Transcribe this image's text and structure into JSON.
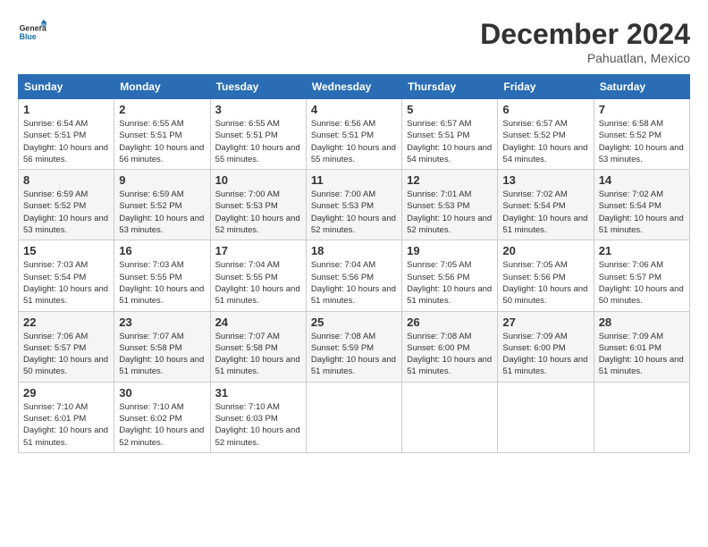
{
  "logo": {
    "general": "General",
    "blue": "Blue"
  },
  "title": {
    "month_year": "December 2024",
    "location": "Pahuatlan, Mexico"
  },
  "calendar": {
    "headers": [
      "Sunday",
      "Monday",
      "Tuesday",
      "Wednesday",
      "Thursday",
      "Friday",
      "Saturday"
    ],
    "weeks": [
      [
        {
          "day": "1",
          "sunrise": "6:54 AM",
          "sunset": "5:51 PM",
          "daylight": "10 hours and 56 minutes."
        },
        {
          "day": "2",
          "sunrise": "6:55 AM",
          "sunset": "5:51 PM",
          "daylight": "10 hours and 56 minutes."
        },
        {
          "day": "3",
          "sunrise": "6:55 AM",
          "sunset": "5:51 PM",
          "daylight": "10 hours and 55 minutes."
        },
        {
          "day": "4",
          "sunrise": "6:56 AM",
          "sunset": "5:51 PM",
          "daylight": "10 hours and 55 minutes."
        },
        {
          "day": "5",
          "sunrise": "6:57 AM",
          "sunset": "5:51 PM",
          "daylight": "10 hours and 54 minutes."
        },
        {
          "day": "6",
          "sunrise": "6:57 AM",
          "sunset": "5:52 PM",
          "daylight": "10 hours and 54 minutes."
        },
        {
          "day": "7",
          "sunrise": "6:58 AM",
          "sunset": "5:52 PM",
          "daylight": "10 hours and 53 minutes."
        }
      ],
      [
        {
          "day": "8",
          "sunrise": "6:59 AM",
          "sunset": "5:52 PM",
          "daylight": "10 hours and 53 minutes."
        },
        {
          "day": "9",
          "sunrise": "6:59 AM",
          "sunset": "5:52 PM",
          "daylight": "10 hours and 53 minutes."
        },
        {
          "day": "10",
          "sunrise": "7:00 AM",
          "sunset": "5:53 PM",
          "daylight": "10 hours and 52 minutes."
        },
        {
          "day": "11",
          "sunrise": "7:00 AM",
          "sunset": "5:53 PM",
          "daylight": "10 hours and 52 minutes."
        },
        {
          "day": "12",
          "sunrise": "7:01 AM",
          "sunset": "5:53 PM",
          "daylight": "10 hours and 52 minutes."
        },
        {
          "day": "13",
          "sunrise": "7:02 AM",
          "sunset": "5:54 PM",
          "daylight": "10 hours and 51 minutes."
        },
        {
          "day": "14",
          "sunrise": "7:02 AM",
          "sunset": "5:54 PM",
          "daylight": "10 hours and 51 minutes."
        }
      ],
      [
        {
          "day": "15",
          "sunrise": "7:03 AM",
          "sunset": "5:54 PM",
          "daylight": "10 hours and 51 minutes."
        },
        {
          "day": "16",
          "sunrise": "7:03 AM",
          "sunset": "5:55 PM",
          "daylight": "10 hours and 51 minutes."
        },
        {
          "day": "17",
          "sunrise": "7:04 AM",
          "sunset": "5:55 PM",
          "daylight": "10 hours and 51 minutes."
        },
        {
          "day": "18",
          "sunrise": "7:04 AM",
          "sunset": "5:56 PM",
          "daylight": "10 hours and 51 minutes."
        },
        {
          "day": "19",
          "sunrise": "7:05 AM",
          "sunset": "5:56 PM",
          "daylight": "10 hours and 51 minutes."
        },
        {
          "day": "20",
          "sunrise": "7:05 AM",
          "sunset": "5:56 PM",
          "daylight": "10 hours and 50 minutes."
        },
        {
          "day": "21",
          "sunrise": "7:06 AM",
          "sunset": "5:57 PM",
          "daylight": "10 hours and 50 minutes."
        }
      ],
      [
        {
          "day": "22",
          "sunrise": "7:06 AM",
          "sunset": "5:57 PM",
          "daylight": "10 hours and 50 minutes."
        },
        {
          "day": "23",
          "sunrise": "7:07 AM",
          "sunset": "5:58 PM",
          "daylight": "10 hours and 51 minutes."
        },
        {
          "day": "24",
          "sunrise": "7:07 AM",
          "sunset": "5:58 PM",
          "daylight": "10 hours and 51 minutes."
        },
        {
          "day": "25",
          "sunrise": "7:08 AM",
          "sunset": "5:59 PM",
          "daylight": "10 hours and 51 minutes."
        },
        {
          "day": "26",
          "sunrise": "7:08 AM",
          "sunset": "6:00 PM",
          "daylight": "10 hours and 51 minutes."
        },
        {
          "day": "27",
          "sunrise": "7:09 AM",
          "sunset": "6:00 PM",
          "daylight": "10 hours and 51 minutes."
        },
        {
          "day": "28",
          "sunrise": "7:09 AM",
          "sunset": "6:01 PM",
          "daylight": "10 hours and 51 minutes."
        }
      ],
      [
        {
          "day": "29",
          "sunrise": "7:10 AM",
          "sunset": "6:01 PM",
          "daylight": "10 hours and 51 minutes."
        },
        {
          "day": "30",
          "sunrise": "7:10 AM",
          "sunset": "6:02 PM",
          "daylight": "10 hours and 52 minutes."
        },
        {
          "day": "31",
          "sunrise": "7:10 AM",
          "sunset": "6:03 PM",
          "daylight": "10 hours and 52 minutes."
        },
        null,
        null,
        null,
        null
      ]
    ],
    "labels": {
      "sunrise": "Sunrise:",
      "sunset": "Sunset:",
      "daylight": "Daylight:"
    }
  }
}
